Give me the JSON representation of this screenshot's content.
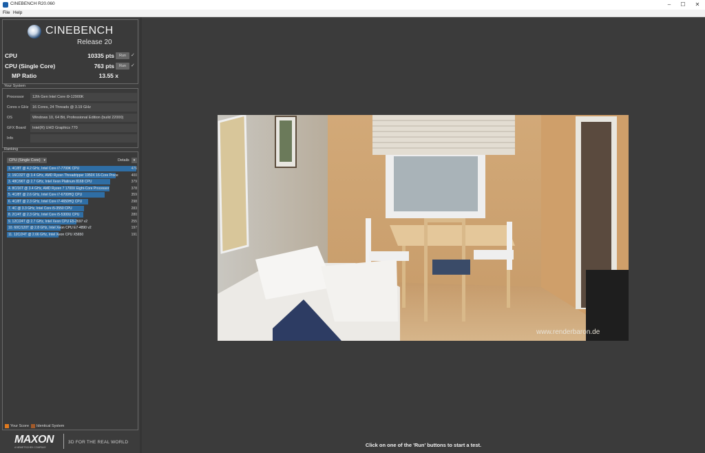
{
  "window": {
    "title": "CINEBENCH R20.060"
  },
  "menu": [
    "File",
    "Help"
  ],
  "header": {
    "brand": "CINEBENCH",
    "release": "Release 20"
  },
  "scores": [
    {
      "label": "CPU",
      "value": "10335 pts",
      "button": "Run"
    },
    {
      "label": "CPU (Single Core)",
      "value": "763 pts",
      "button": "Run"
    },
    {
      "label": "MP Ratio",
      "value": "13.55 x"
    }
  ],
  "system": {
    "title": "Your System",
    "rows": [
      {
        "label": "Processor",
        "value": "12th Gen Intel Core i9-12900K"
      },
      {
        "label": "Cores x GHz",
        "value": "16 Cores, 24 Threads @ 3.19 GHz"
      },
      {
        "label": "OS",
        "value": "Windows 10, 64 Bit, Professional Edition (build 22000)"
      },
      {
        "label": "GFX Board",
        "value": "Intel(R) UHD Graphics 770"
      },
      {
        "label": "Info",
        "value": ""
      }
    ]
  },
  "ranking": {
    "title": "Ranking",
    "filter": "CPU (Single Core)",
    "details_label": "Details",
    "items": [
      {
        "label": "1. 4C/8T @ 4.2 GHz, Intel Core i7-7700K CPU",
        "score": "476"
      },
      {
        "label": "2. 16C/32T @ 3.4 GHz, AMD Ryzen Threadripper 1950X 16-Core Proce",
        "score": "400"
      },
      {
        "label": "3. 48C/96T @ 2.7 GHz, Intel Xeon Platinum 8168 CPU",
        "score": "379"
      },
      {
        "label": "4. 8C/16T @ 3.4 GHz, AMD Ryzen 7 1700X Eight-Core Processor",
        "score": "378"
      },
      {
        "label": "5. 4C/8T @ 2.6 GHz, Intel Core i7-6700HQ CPU",
        "score": "359"
      },
      {
        "label": "6. 4C/8T @ 2.3 GHz, Intel Core i7-4650HQ CPU",
        "score": "298"
      },
      {
        "label": "7. 4C @ 3.3 GHz, Intel Core i5-3550 CPU",
        "score": "283"
      },
      {
        "label": "8. 2C/4T @ 2.3 GHz, Intel Core i5-5300U CPU",
        "score": "280"
      },
      {
        "label": "9. 12C/24T @ 2.7 GHz, Intel Xeon CPU E5-2697 v2",
        "score": "255"
      },
      {
        "label": "10. 60C/120T @ 2.8 GHz, Intel Xeon CPU E7-4890 v2",
        "score": "197"
      },
      {
        "label": "11. 12C/24T @ 2.66 GHz, Intel Xeon CPU X5650",
        "score": "191"
      }
    ],
    "legend": [
      {
        "label": "Your Score",
        "color": "#e07a1f"
      },
      {
        "label": "Identical System",
        "color": "#a25a2a"
      }
    ]
  },
  "footer": {
    "brand": "MAXON",
    "brand_sub": "A NEMETSCHEK COMPANY",
    "tagline": "3D FOR THE REAL WORLD"
  },
  "render": {
    "watermark": "www.renderbaron.de"
  },
  "status": "Click on one of the 'Run' buttons to start a test."
}
